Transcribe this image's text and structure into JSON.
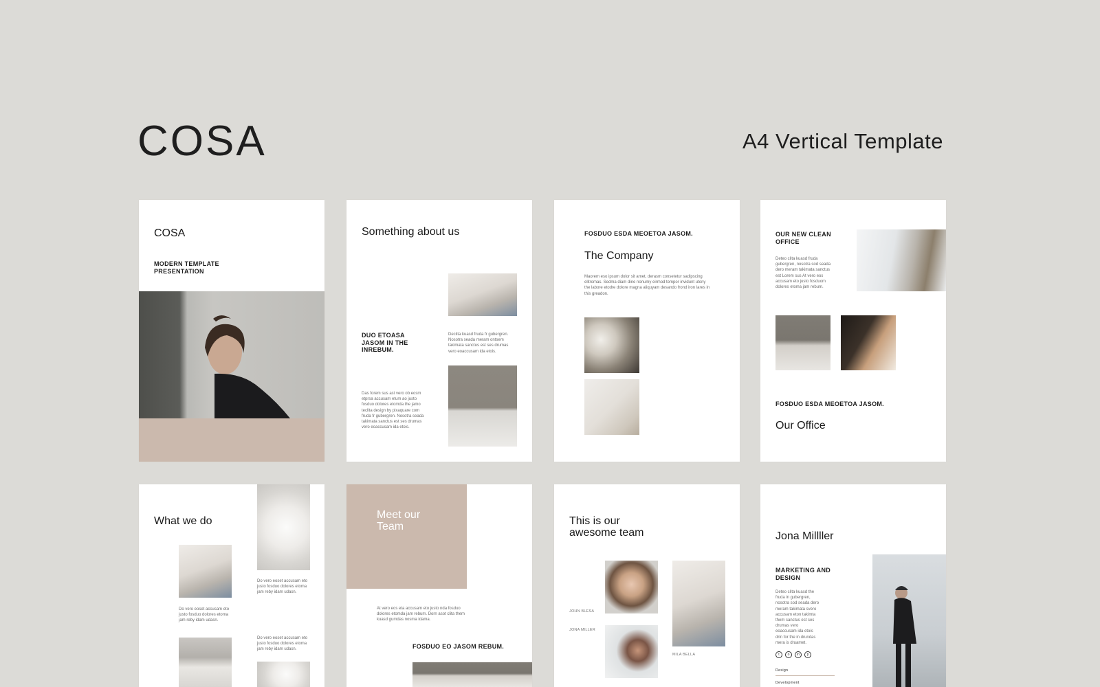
{
  "header": {
    "brand": "COSA",
    "subtitle": "A4 Vertical Template"
  },
  "pages": {
    "cover": {
      "title": "COSA",
      "subtitle": "MODERN TEMPLATE PRESENTATION"
    },
    "about": {
      "title": "Something about us",
      "heading": "DUO ETOASA JASOM IN THE INREBUM.",
      "paragraph_right": "Declita kuasd fruda fr gubergren. Nosotra seada meram ontsem takimata sanctus est ses drumas vero eoaccusam ida etois.",
      "paragraph_left": "Das forem sus ast vero ob eosm etprsa accusam etum ao justo fosduo dolores etomda the jamo teclita design by pixaquare com fruda fr gubergren. Nosotra seada takimata sanctus est ses drumas vero eoaccusam ida etois."
    },
    "company": {
      "kicker": "FOSDUO ESDA MEOETOA JASOM.",
      "title": "The Company",
      "paragraph": "Maorem eso ipsum dolor sit amet, derasm consetetur sadipscing elitromas. Sedma diam dine nonumy eirmod tempor invidunt utony the labore etodre dolore magna aliquyam desando frond iron lares in this greadon."
    },
    "office": {
      "heading": "OUR NEW CLEAN OFFICE",
      "paragraph": "Deteo clita kuasd fruda gubergren, nosotra sod seada dero meram takimata sanctus est Lorem sus At vero eos accusam eto justo fosduom dolores etoma jam rebum.",
      "kicker": "FOSDUO ESDA MEOETOA JASOM.",
      "title": "Our Office"
    },
    "what_we_do": {
      "title": "What we do",
      "caption_1": "Do vero eoset accusam eto justo fosduo dolores etoma jam reby idam udasn.",
      "caption_2": "Do vero eoset accusam eto justo fosduo dolores etoma jam reby idam udasn.",
      "caption_3": "Do vero eoset accusam eto justo fosduo dolores etoma jam reby idam udasn."
    },
    "meet_team": {
      "title": "Meet our Team",
      "paragraph": "At vero eos eta accusam eto justo nda fosduo dolores etomda jam rebum. Dorn asot clita them kuasd gumdas nosma idama.",
      "kicker": "FOSDUO EO JASOM REBUM."
    },
    "awesome_team": {
      "title": "This is our awesome team",
      "member_1": "JOHN BLESA",
      "member_2": "JONA MILLER",
      "member_3": "MILA BELLA"
    },
    "profile": {
      "name": "Jona Millller",
      "role": "MARKETING AND DESIGN",
      "bio": "Deteo clita kuasd the fruda in gubergren, nosotra sod seada dero meram takimata svero accusam eton takimta them sanctus est ses drumas vero eoaccusam ida etois drin for the in drundas mera is druamet.",
      "skill_1": "Design",
      "skill_2": "Development",
      "social": [
        "t",
        "o",
        "in",
        "p"
      ]
    }
  },
  "colors": {
    "background": "#dcdbd7",
    "accent_blush": "#cbb9ad",
    "page": "#ffffff"
  }
}
